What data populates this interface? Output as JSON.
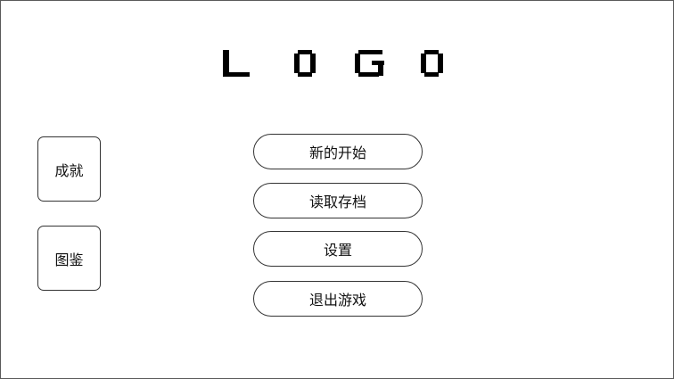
{
  "logo": {
    "letters": [
      "L",
      "O",
      "G",
      "O"
    ],
    "color": "#000000"
  },
  "side_buttons": {
    "achievements": "成就",
    "gallery": "图鉴"
  },
  "menu": {
    "new_game": "新的开始",
    "load_game": "读取存档",
    "settings": "设置",
    "quit": "退出游戏"
  },
  "colors": {
    "background": "#ffffff",
    "border": "#333333",
    "text": "#111111"
  }
}
